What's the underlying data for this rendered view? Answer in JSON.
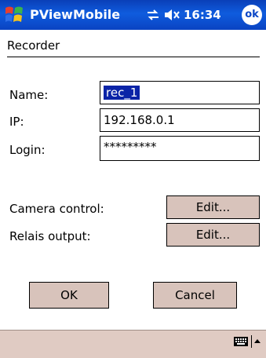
{
  "statusbar": {
    "app_title": "PViewMobile",
    "clock": "16:34",
    "ok_label": "ok"
  },
  "dialog": {
    "title": "Recorder",
    "fields": {
      "name_label": "Name:",
      "name_value": "rec_1",
      "ip_label": "IP:",
      "ip_value": "192.168.0.1",
      "login_label": "Login:",
      "login_value": "*********"
    },
    "camera_control_label": "Camera control:",
    "relais_output_label": "Relais output:",
    "edit_label": "Edit...",
    "ok_button": "OK",
    "cancel_button": "Cancel"
  },
  "colors": {
    "titlebar": "#0f5cde",
    "bottombar": "#e0cbc3",
    "button": "#d8c3bb",
    "selection": "#0b24a7"
  }
}
